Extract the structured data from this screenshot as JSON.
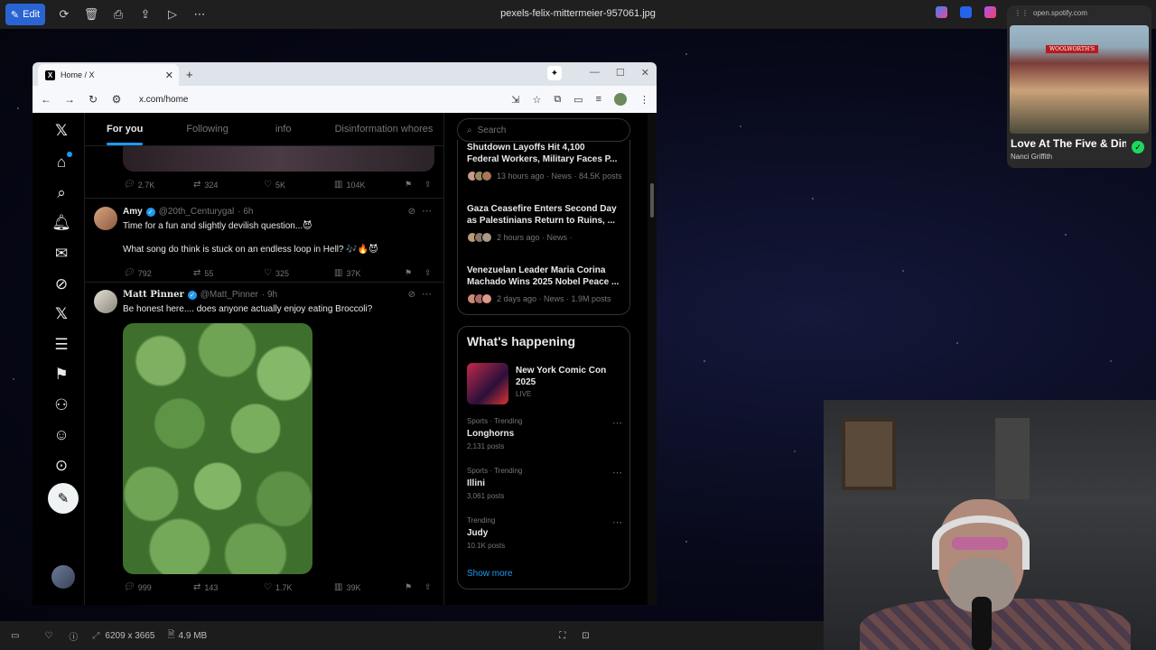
{
  "viewer": {
    "edit_label": "Edit",
    "file_name": "pexels-felix-mittermeier-957061.jpg",
    "dimensions": "6209 x 3665",
    "file_size": "4.9 MB"
  },
  "browser": {
    "tab_title": "Home / X",
    "url": "x.com/home"
  },
  "feed": {
    "tabs": [
      "For you",
      "Following",
      "info",
      "Disinformation whores"
    ],
    "top_actions": {
      "replies": "2.7K",
      "reposts": "324",
      "likes": "5K",
      "views": "104K"
    },
    "tweets": [
      {
        "name": "Amy",
        "handle": "@20th_Centurygal",
        "time": "· 6h",
        "text1": "Time for a fun and slightly devilish question...😈",
        "text2": "What song do think is stuck on an endless loop in Hell? 🎶🔥😈",
        "replies": "792",
        "reposts": "55",
        "likes": "325",
        "views": "37K"
      },
      {
        "name": "Matt Pinner",
        "handle": "@Matt_Pinner",
        "time": "· 9h",
        "text1": "Be honest here.... does anyone actually enjoy eating Broccoli?",
        "replies": "999",
        "reposts": "143",
        "likes": "1.7K",
        "views": "39K"
      }
    ]
  },
  "sidebar": {
    "search_placeholder": "Search",
    "news": [
      {
        "title": "Shutdown Layoffs Hit 4,100\nFederal Workers, Military Faces P...",
        "meta": "13 hours ago · News · 84.5K posts"
      },
      {
        "title": "Gaza Ceasefire Enters Second Day\nas Palestinians Return to Ruins, ...",
        "meta": "2 hours ago · News ·"
      },
      {
        "title": "Venezuelan Leader Maria Corina\nMachado Wins 2025 Nobel Peace ...",
        "meta": "2 days ago · News · 1.9M posts"
      }
    ],
    "whats_happening": "What's happening",
    "event": {
      "title": "New York Comic Con 2025",
      "status": "LIVE"
    },
    "trends": [
      {
        "meta": "Sports · Trending",
        "name": "Longhorns",
        "posts": "2,131 posts"
      },
      {
        "meta": "Sports · Trending",
        "name": "Illini",
        "posts": "3,061 posts"
      },
      {
        "meta": "Trending",
        "name": "Judy",
        "posts": "10.1K posts"
      }
    ],
    "show_more": "Show more"
  },
  "spotify": {
    "url": "open.spotify.com",
    "song": "Love At The Five & Dime",
    "artist": "Nanci Griffith",
    "album_sign": "WOOLWORTH'S"
  }
}
